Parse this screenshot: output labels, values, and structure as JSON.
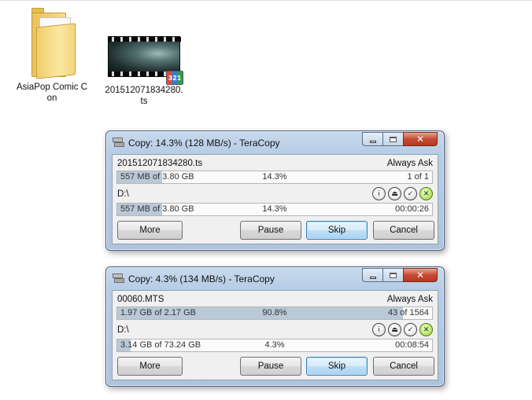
{
  "desktop": {
    "icons": [
      {
        "label": "AsiaPop Comic Con",
        "icon": "folder-icon"
      },
      {
        "label": "201512071834280.ts",
        "icon": "video-file-icon"
      }
    ]
  },
  "windows": [
    {
      "title": "Copy: 14.3%  (128 MB/s) - TeraCopy",
      "file_name": "201512071834280.ts",
      "overwrite_mode": "Always Ask",
      "file_progress": {
        "fraction": 0.143,
        "left": "557 MB of 3.80 GB",
        "center": "14.3%",
        "right": "1 of 1"
      },
      "destination": "D:\\",
      "total_progress": {
        "fraction": 0.143,
        "left": "557 MB of 3.80 GB",
        "center": "14.3%",
        "right": "00:00:26"
      },
      "buttons": {
        "more": "More",
        "pause": "Pause",
        "skip": "Skip",
        "cancel": "Cancel"
      }
    },
    {
      "title": "Copy: 4.3%  (134 MB/s) - TeraCopy",
      "file_name": "00060.MTS",
      "overwrite_mode": "Always Ask",
      "file_progress": {
        "fraction": 0.908,
        "left": "1.97 GB of 2.17 GB",
        "center": "90.8%",
        "right": "43 of 1564"
      },
      "destination": "D:\\",
      "total_progress": {
        "fraction": 0.043,
        "left": "3.14 GB of 73.24 GB",
        "center": "4.3%",
        "right": "00:08:54"
      },
      "buttons": {
        "more": "More",
        "pause": "Pause",
        "skip": "Skip",
        "cancel": "Cancel"
      }
    }
  ],
  "colors": {
    "progress_fill": "#b9c9d8",
    "close_button": "#c74a34",
    "title_glass": "#b7cde6"
  }
}
